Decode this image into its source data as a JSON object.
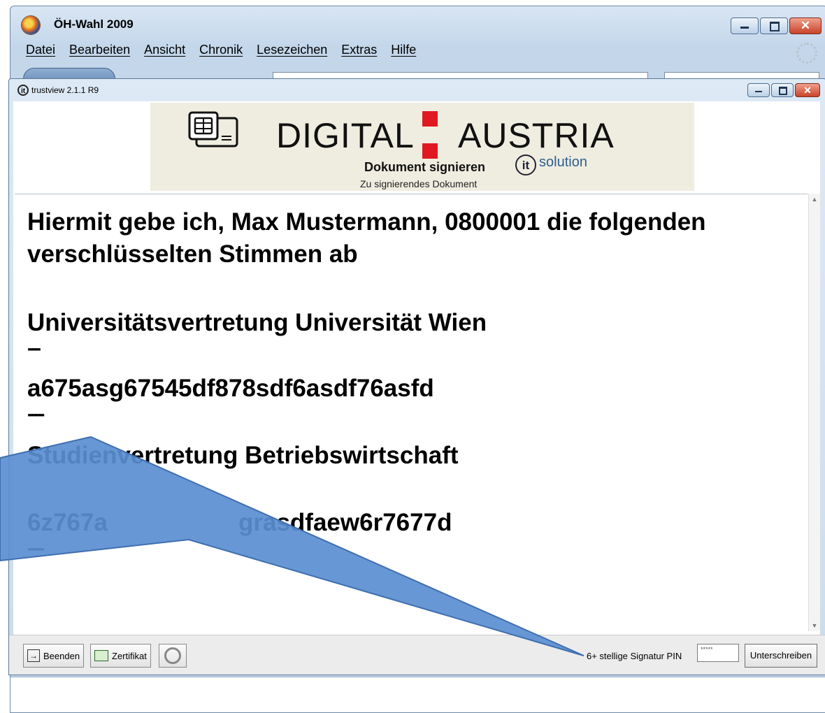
{
  "browser": {
    "title": "ÖH-Wahl 2009",
    "menu": [
      "Datei",
      "Bearbeiten",
      "Ansicht",
      "Chronik",
      "Lesezeichen",
      "Extras",
      "Hilfe"
    ]
  },
  "app": {
    "title": "trustview 2.1.1 R9",
    "banner": {
      "brand_left": "DIGITAL",
      "brand_right": "AUSTRIA",
      "subtitle": "Dokument signieren",
      "partner": "solution",
      "partner_logo": "it",
      "note": "Zu signierendes Dokument"
    },
    "document": {
      "lines": [
        "Hiermit gebe ich, Max Mustermann, 0800001 die folgenden",
        "verschlüsselten Stimmen ab",
        "Universitätsvertretung Universität Wien",
        "---",
        "a675asg67545df878sdf6asdf76asfd",
        "----",
        "Studienvertretung Betriebswirtschaft",
        "6z767a",
        "grasdfaew6r7677d",
        "----"
      ]
    },
    "footer": {
      "quit_label": "Beenden",
      "cert_label": "Zertifikat",
      "pin_label": "6+ stellige Signatur PIN",
      "pin_value": "*****",
      "sign_label": "Unterschreiben"
    }
  },
  "colors": {
    "callout_fill": "#5b8ed1",
    "callout_stroke": "#3f6fb0",
    "brand_red": "#e01822",
    "banner_bg": "#efede0"
  }
}
